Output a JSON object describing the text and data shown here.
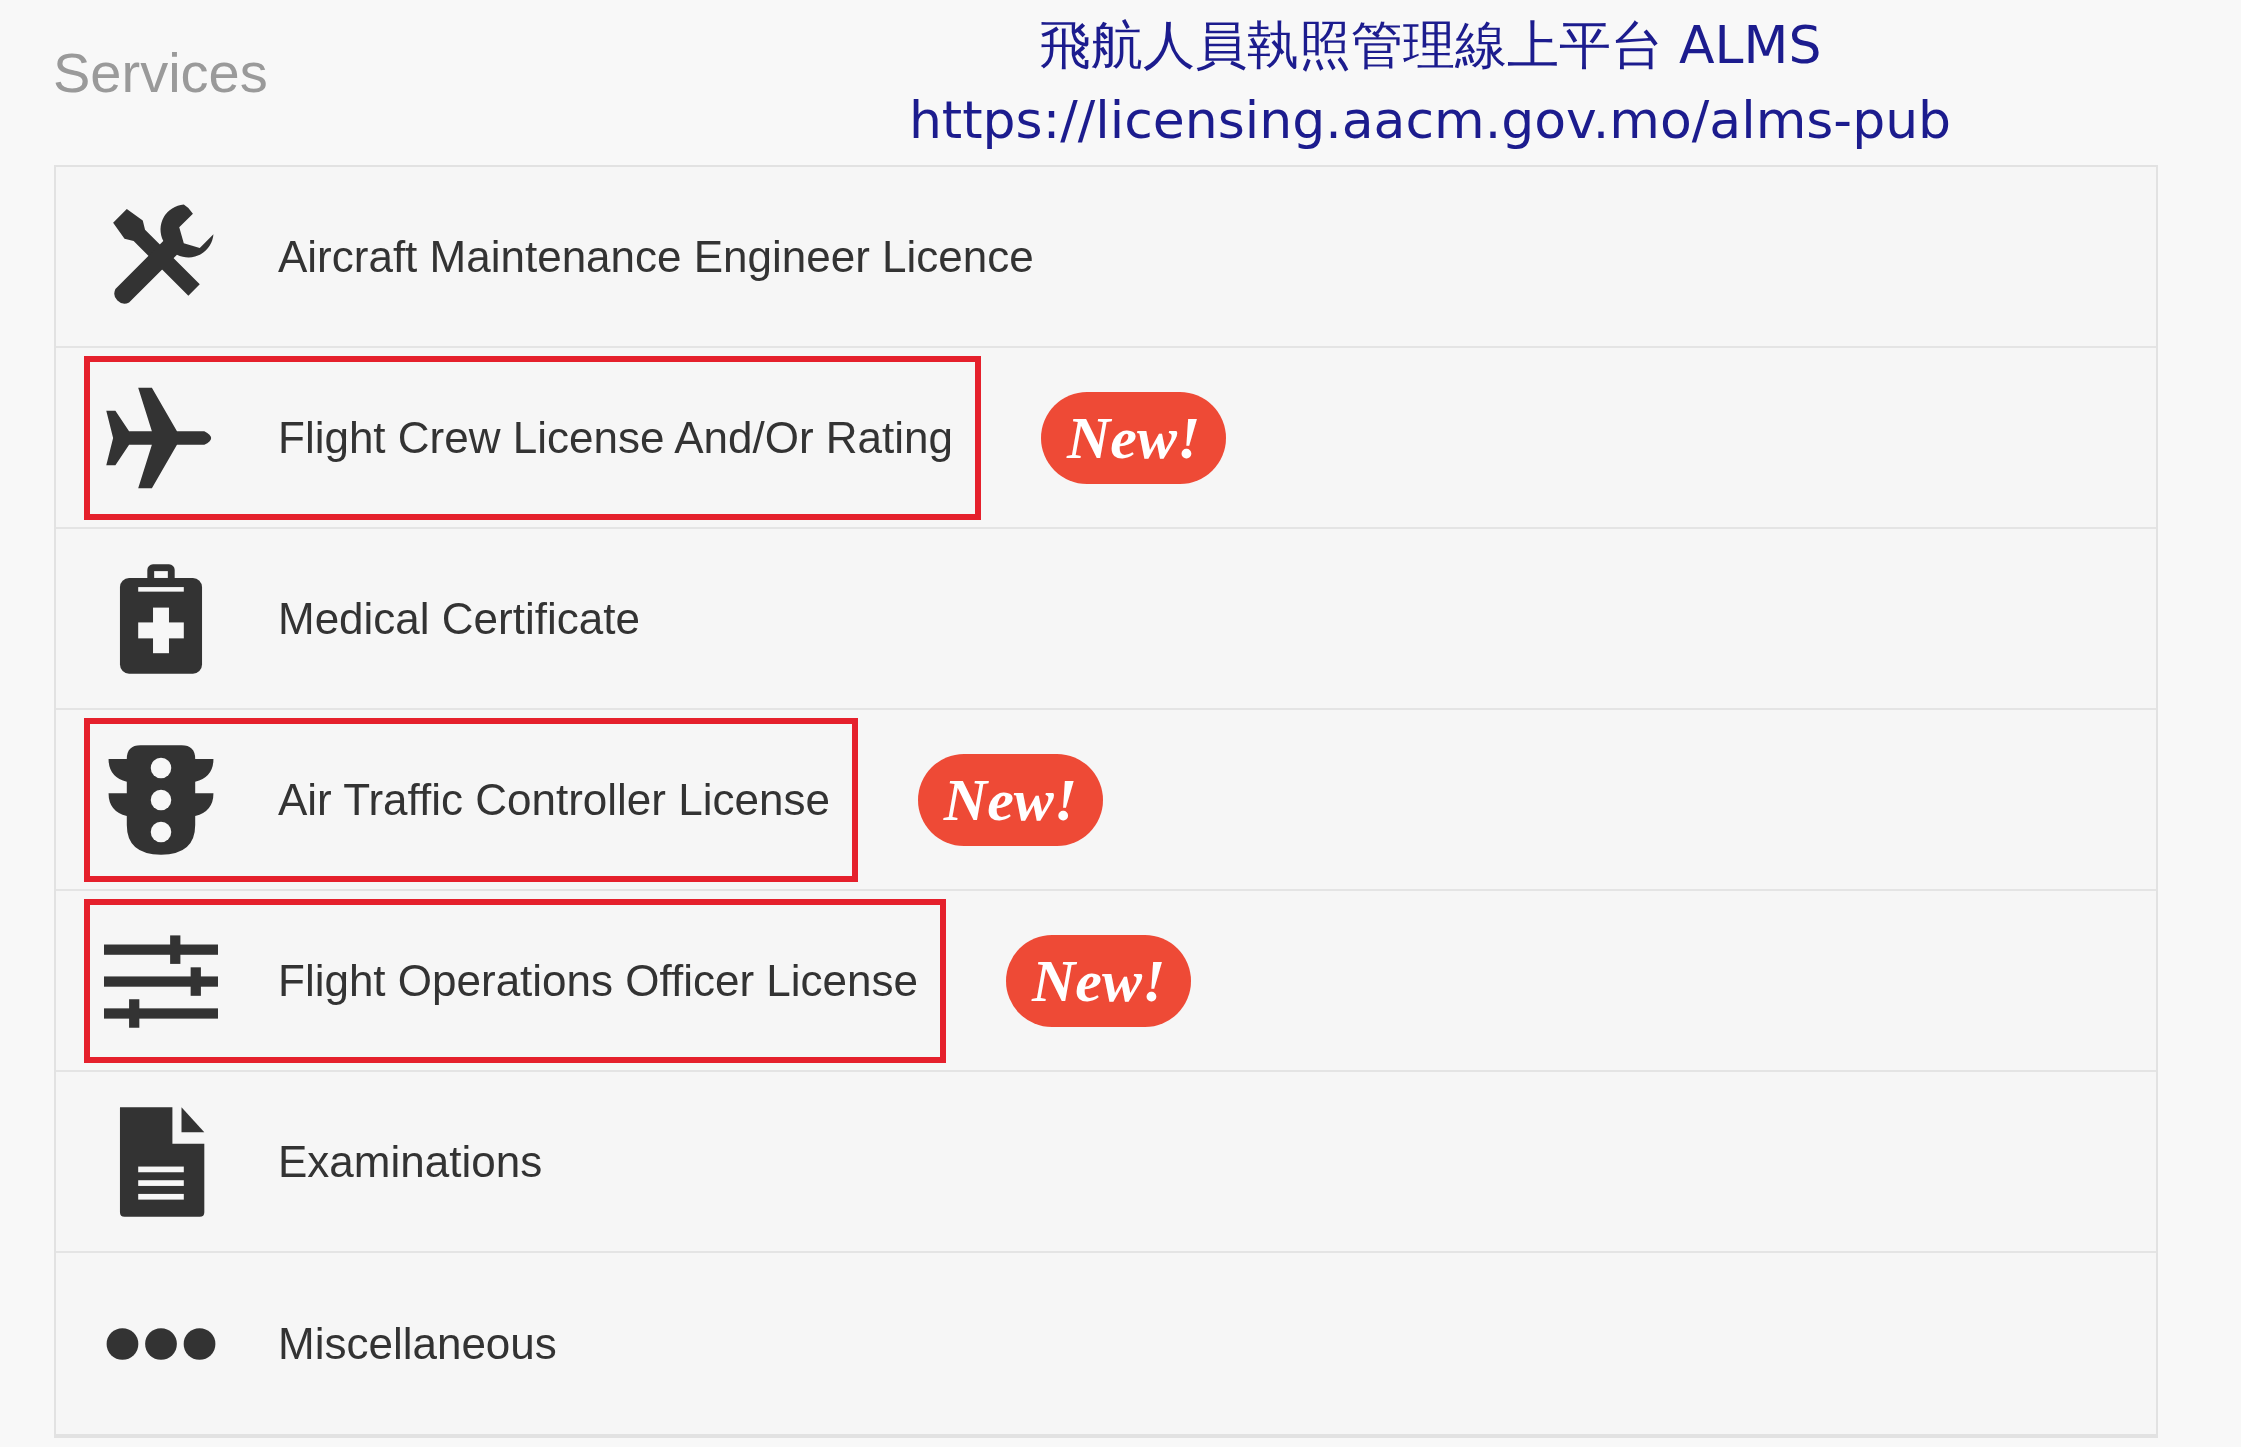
{
  "title": "Services",
  "banner": {
    "name": "飛航人員執照管理線上平台 ALMS",
    "url": "https://licensing.aacm.gov.mo/alms-pub"
  },
  "services": [
    {
      "kind": "tools",
      "label": "Aircraft Maintenance Engineer Licence",
      "highlighted": false
    },
    {
      "kind": "plane",
      "label": "Flight Crew License And/Or Rating",
      "highlighted": true,
      "badge": "New!"
    },
    {
      "kind": "clipboard",
      "label": "Medical Certificate",
      "highlighted": false
    },
    {
      "kind": "traffic",
      "label": "Air Traffic Controller License",
      "highlighted": true,
      "badge": "New!"
    },
    {
      "kind": "sliders",
      "label": "Flight Operations Officer License",
      "highlighted": true,
      "badge": "New!"
    },
    {
      "kind": "document",
      "label": "Examinations",
      "highlighted": false
    },
    {
      "kind": "dots",
      "label": "Miscellaneous",
      "highlighted": false
    }
  ]
}
